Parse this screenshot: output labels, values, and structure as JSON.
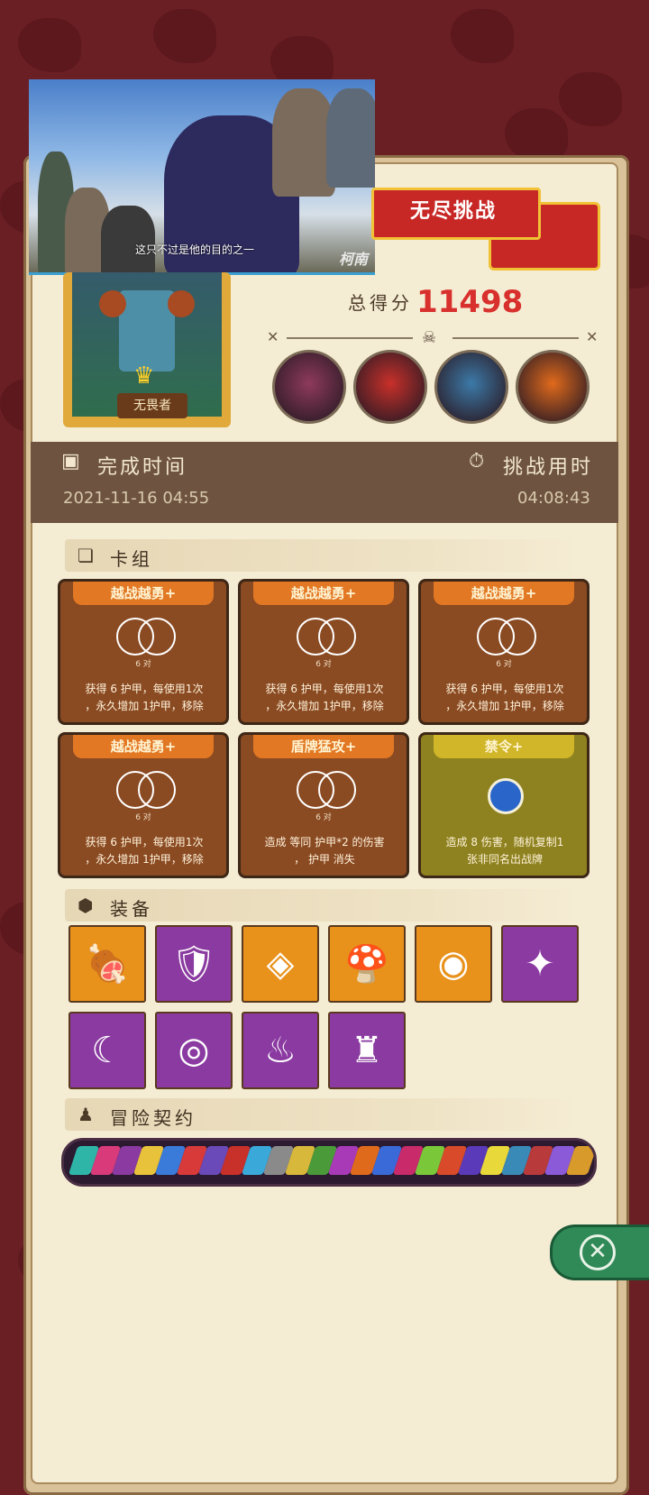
{
  "video": {
    "subtitle": "这只不过是他的目的之一",
    "logo": "柯南"
  },
  "hero": {
    "name": "无畏者"
  },
  "banner": {
    "title": "无尽挑战"
  },
  "score": {
    "label": "总得分",
    "value": "11498"
  },
  "bosses": [
    {
      "name": "stone-golem-boss",
      "color": "#8e3a5c"
    },
    {
      "name": "red-monster-boss",
      "color": "#c8302a"
    },
    {
      "name": "blue-beast-boss",
      "color": "#3c7aa8"
    },
    {
      "name": "lion-mask-boss",
      "color": "#e06a1c"
    }
  ],
  "time": {
    "finish_label": "完成时间",
    "finish_value": "2021-11-16 04:55",
    "duration_label": "挑战用时",
    "duration_value": "04:08:43"
  },
  "sections": {
    "deck": "卡组",
    "equipment": "装备",
    "contract": "冒险契约"
  },
  "cards": [
    {
      "title": "越战越勇+",
      "sub": "6 对",
      "desc1": "获得 6 护甲，每使用1次",
      "desc2": "，永久增加 1护甲，移除"
    },
    {
      "title": "越战越勇+",
      "sub": "6 对",
      "desc1": "获得 6 护甲，每使用1次",
      "desc2": "，永久增加 1护甲，移除"
    },
    {
      "title": "越战越勇+",
      "sub": "6 对",
      "desc1": "获得 6 护甲，每使用1次",
      "desc2": "，永久增加 1护甲，移除"
    },
    {
      "title": "越战越勇+",
      "sub": "6 对",
      "desc1": "获得 6 护甲，每使用1次",
      "desc2": "，永久增加 1护甲，移除"
    },
    {
      "title": "盾牌猛攻+",
      "sub": "6 对",
      "desc1": "造成 等同 护甲*2 的伤害",
      "desc2": "， 护甲 消失"
    },
    {
      "title": "禁令+",
      "sub": "",
      "desc1": "造成 8 伤害，随机复制1",
      "desc2": "张非同名出战牌"
    }
  ],
  "equipment": [
    {
      "name": "meat-leg-icon",
      "glyph": "🍖",
      "bg": "o"
    },
    {
      "name": "blue-shield-icon",
      "glyph": "🛡",
      "bg": "p"
    },
    {
      "name": "crystal-shield-icon",
      "glyph": "◈",
      "bg": "o"
    },
    {
      "name": "blue-mushroom-icon",
      "glyph": "🍄",
      "bg": "o"
    },
    {
      "name": "ring-donut-icon",
      "glyph": "◉",
      "bg": "o"
    },
    {
      "name": "dark-dice-icon",
      "glyph": "✦",
      "bg": "p"
    },
    {
      "name": "moon-star-icon",
      "glyph": "☾",
      "bg": "p"
    },
    {
      "name": "mirror-icon",
      "glyph": "◎",
      "bg": "p"
    },
    {
      "name": "red-potion-icon",
      "glyph": "♨",
      "bg": "p"
    },
    {
      "name": "armor-vest-icon",
      "glyph": "♜",
      "bg": "p"
    }
  ],
  "contract_colors": [
    "#2fb5a8",
    "#d83a7a",
    "#8a3aa0",
    "#e8c23a",
    "#3a7ad8",
    "#d83a3a",
    "#6a4ab8",
    "#c8302a",
    "#3aa8d8",
    "#8a8a8a",
    "#d8b83a",
    "#4a9a3a",
    "#a83ab8",
    "#e06a1c",
    "#3a6ad8",
    "#c82a6a",
    "#7ac83a",
    "#d84a2a",
    "#5a3ab8",
    "#e8d83a",
    "#3a8ab8",
    "#b83a3a",
    "#8a5ad8",
    "#d89a2a"
  ]
}
